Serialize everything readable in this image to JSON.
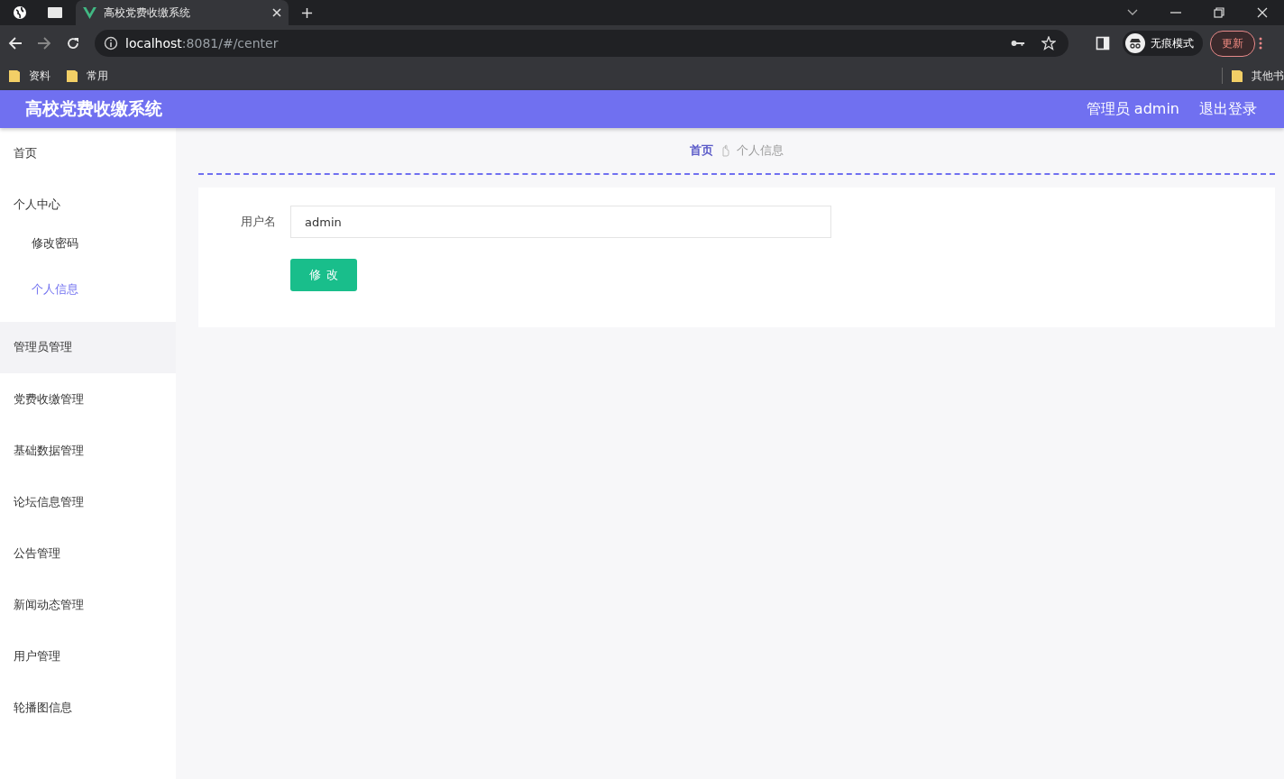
{
  "browser": {
    "tabs": [
      {
        "title": "高校党费收缴系统",
        "selected": true
      }
    ],
    "address": {
      "host": "localhost",
      "path": ":8081/#/center"
    },
    "profile": "无痕模式",
    "update_button": "更新",
    "bookmarks": [
      "资料",
      "常用"
    ],
    "other_bookmarks": "其他书"
  },
  "app": {
    "title": "高校党费收缴系统",
    "user": "管理员 admin",
    "logout": "退出登录",
    "sidebar": [
      {
        "label": "首页",
        "selected": false,
        "hovered": false
      },
      {
        "label": "个人中心",
        "selected": false,
        "hovered": false,
        "expanded": true,
        "children": [
          {
            "label": "修改密码",
            "selected": false
          },
          {
            "label": "个人信息",
            "selected": true
          }
        ]
      },
      {
        "label": "管理员管理",
        "selected": false,
        "hovered": true
      },
      {
        "label": "党费收缴管理",
        "selected": false,
        "hovered": false
      },
      {
        "label": "基础数据管理",
        "selected": false,
        "hovered": false
      },
      {
        "label": "论坛信息管理",
        "selected": false,
        "hovered": false
      },
      {
        "label": "公告管理",
        "selected": false,
        "hovered": false
      },
      {
        "label": "新闻动态管理",
        "selected": false,
        "hovered": false
      },
      {
        "label": "用户管理",
        "selected": false,
        "hovered": false
      },
      {
        "label": "轮播图信息",
        "selected": false,
        "hovered": false
      }
    ],
    "breadcrumb": [
      "首页",
      "个人信息"
    ],
    "form": {
      "label": "用户名",
      "value": "admin",
      "button": "修改"
    }
  }
}
